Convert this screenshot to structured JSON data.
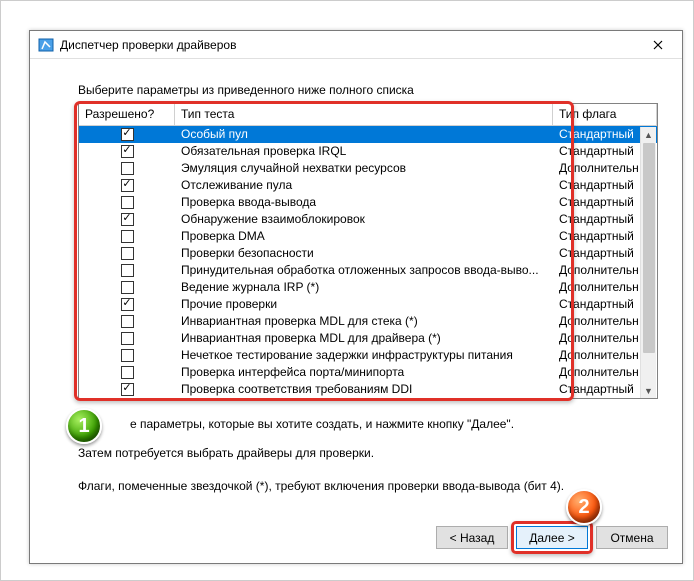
{
  "window": {
    "title": "Диспетчер проверки драйверов"
  },
  "instruction": "Выберите параметры из приведенного ниже полного списка",
  "columns": {
    "allowed": "Разрешено?",
    "test_type": "Тип теста",
    "flag_type": "Тип флага"
  },
  "rows": [
    {
      "checked": true,
      "test": "Особый пул",
      "flag": "Стандартный",
      "selected": true
    },
    {
      "checked": true,
      "test": "Обязательная проверка IRQL",
      "flag": "Стандартный"
    },
    {
      "checked": false,
      "test": "Эмуляция случайной нехватки ресурсов",
      "flag": "Дополнительный"
    },
    {
      "checked": true,
      "test": "Отслеживание пула",
      "flag": "Стандартный"
    },
    {
      "checked": false,
      "test": "Проверка ввода-вывода",
      "flag": "Стандартный"
    },
    {
      "checked": true,
      "test": "Обнаружение взаимоблокировок",
      "flag": "Стандартный"
    },
    {
      "checked": false,
      "test": "Проверка DMA",
      "flag": "Стандартный"
    },
    {
      "checked": false,
      "test": "Проверки безопасности",
      "flag": "Стандартный"
    },
    {
      "checked": false,
      "test": "Принудительная обработка отложенных запросов ввода-выво...",
      "flag": "Дополнительный"
    },
    {
      "checked": false,
      "test": "Ведение журнала IRP (*)",
      "flag": "Дополнительный"
    },
    {
      "checked": true,
      "test": "Прочие проверки",
      "flag": "Стандартный"
    },
    {
      "checked": false,
      "test": "Инвариантная проверка MDL для стека (*)",
      "flag": "Дополнительный"
    },
    {
      "checked": false,
      "test": "Инвариантная проверка MDL для драйвера (*)",
      "flag": "Дополнительный"
    },
    {
      "checked": false,
      "test": "Нечеткое тестирование задержки инфраструктуры питания",
      "flag": "Дополнительный"
    },
    {
      "checked": false,
      "test": "Проверка интерфейса порта/минипорта",
      "flag": "Дополнительный"
    },
    {
      "checked": true,
      "test": "Проверка соответствия требованиям DDI",
      "flag": "Стандартный"
    }
  ],
  "hint1": "е параметры, которые вы хотите создать, и нажмите кнопку \"Далее\".",
  "hint2": "Затем потребуется выбрать драйверы для проверки.",
  "hint3": "Флаги, помеченные звездочкой (*), требуют включения проверки ввода-вывода (бит 4).",
  "buttons": {
    "back": "< Назад",
    "next": "Далее >",
    "cancel": "Отмена"
  },
  "badges": {
    "one": "1",
    "two": "2"
  }
}
